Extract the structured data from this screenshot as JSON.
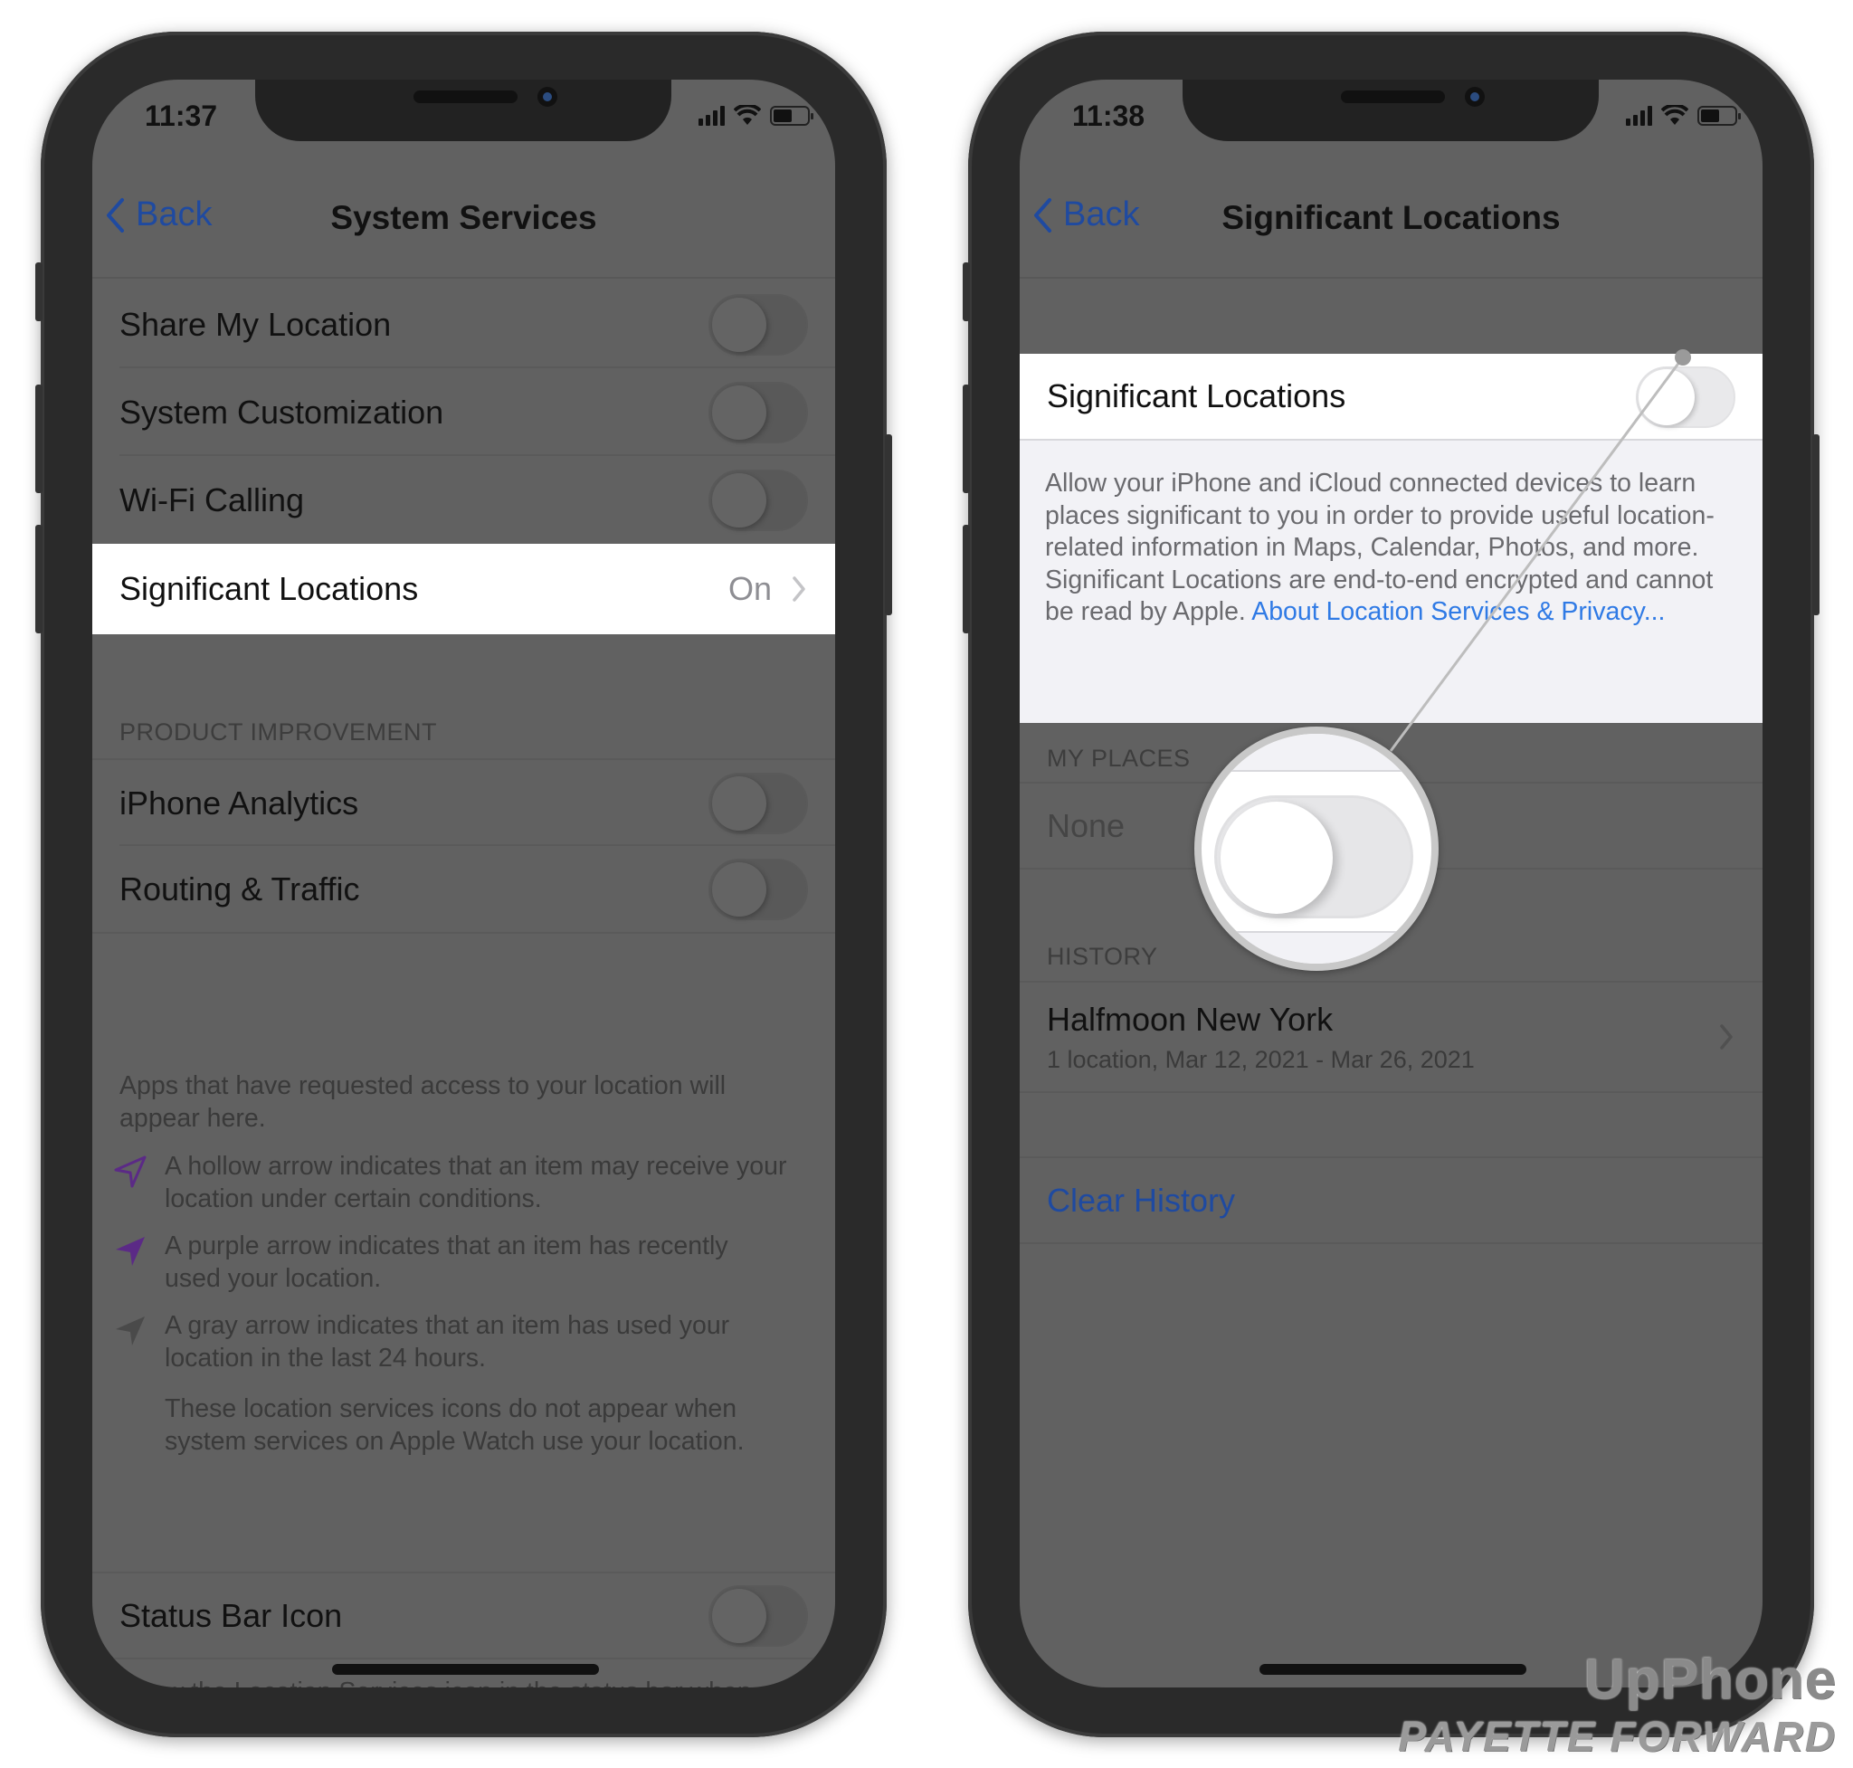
{
  "colors": {
    "dim_overlay_bg": "#616161",
    "highlight_row": "#ffffff",
    "ios_blue_dimmed": "#1f4aa0",
    "ios_blue": "#2f7ae5",
    "purple_arrow": "#5b2a86",
    "gray_arrow": "#4a4a4a"
  },
  "left_phone": {
    "status_bar": {
      "time": "11:37",
      "icons": [
        "cellular-signal-icon",
        "wifi-icon",
        "battery-icon"
      ]
    },
    "nav": {
      "back_label": "Back",
      "title": "System Services"
    },
    "rows": [
      {
        "label": "Share My Location",
        "control": "toggle",
        "state": "off"
      },
      {
        "label": "System Customization",
        "control": "toggle",
        "state": "off"
      },
      {
        "label": "Wi-Fi Calling",
        "control": "toggle",
        "state": "off"
      },
      {
        "label": "Significant Locations",
        "control": "disclosure",
        "value": "On",
        "highlighted": true
      }
    ],
    "product_improvement": {
      "header": "PRODUCT IMPROVEMENT",
      "rows": [
        {
          "label": "iPhone Analytics",
          "control": "toggle",
          "state": "off"
        },
        {
          "label": "Routing & Traffic",
          "control": "toggle",
          "state": "off"
        }
      ]
    },
    "footer": {
      "intro": "Apps that have requested access to your location will appear here.",
      "legend": [
        {
          "icon": "hollow-arrow-icon",
          "text": "A hollow arrow indicates that an item may receive your location under certain conditions."
        },
        {
          "icon": "purple-arrow-icon",
          "text": "A purple arrow indicates that an item has recently used your location."
        },
        {
          "icon": "gray-arrow-icon",
          "text": "A gray arrow indicates that an item has used your location in the last 24 hours."
        }
      ],
      "watch_note": "These location services icons do not appear when system services on Apple Watch use your location."
    },
    "status_bar_icon_row": {
      "label": "Status Bar Icon",
      "control": "toggle",
      "state": "off"
    },
    "status_bar_icon_footer": "Show the Location Services icon in the status bar when the services above request your location."
  },
  "right_phone": {
    "status_bar": {
      "time": "11:38",
      "icons": [
        "cellular-signal-icon",
        "wifi-icon",
        "battery-icon"
      ]
    },
    "nav": {
      "back_label": "Back",
      "title": "Significant Locations"
    },
    "main_toggle": {
      "label": "Significant Locations",
      "state": "off"
    },
    "description": "Allow your iPhone and iCloud connected devices to learn places significant to you in order to provide useful location-related information in Maps, Calendar, Photos, and more. Significant Locations are end-to-end encrypted and cannot be read by Apple.",
    "description_link": "About Location Services & Privacy...",
    "my_places": {
      "header": "MY PLACES",
      "value": "None"
    },
    "history": {
      "header": "HISTORY",
      "items": [
        {
          "title": "Halfmoon New York",
          "subtitle": "1 location, Mar 12, 2021 - Mar 26, 2021"
        }
      ]
    },
    "clear_history_label": "Clear History"
  },
  "watermark": {
    "line1": "UpPhone",
    "line2": "PAYETTE FORWARD"
  }
}
